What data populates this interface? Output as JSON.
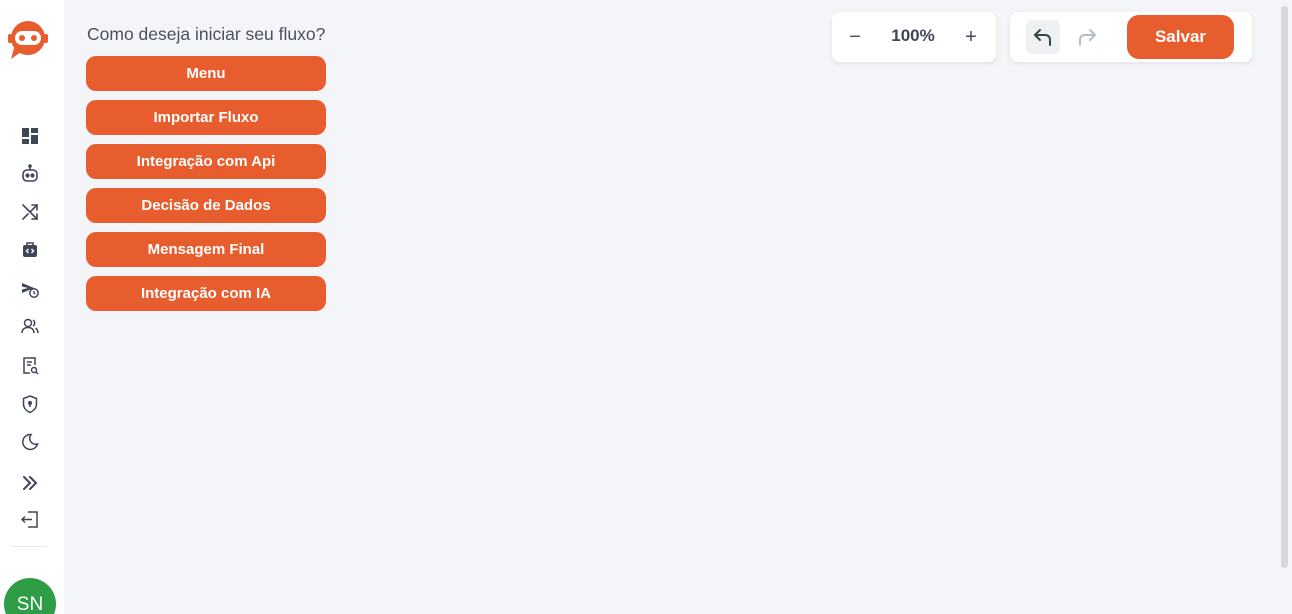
{
  "flow": {
    "prompt": "Como deseja iniciar seu fluxo?",
    "options": [
      "Menu",
      "Importar Fluxo",
      "Integração com Api",
      "Decisão de Dados",
      "Mensagem Final",
      "Integração com IA"
    ]
  },
  "toolbar": {
    "zoom_value": "100%",
    "zoom_out": "−",
    "zoom_in": "+",
    "save_label": "Salvar"
  },
  "user": {
    "initials": "SN"
  },
  "colors": {
    "accent": "#e85d2e",
    "avatar": "#2e9d45",
    "icon": "#3f4656",
    "background": "#f4f5f8"
  },
  "sidebar": {
    "icons": [
      "dashboard-icon",
      "robot-icon",
      "shuffle-icon",
      "code-bag-icon",
      "scheduled-send-icon",
      "contacts-icon",
      "report-search-icon",
      "shield-icon",
      "dark-mode-icon",
      "expand-sidebar-icon",
      "logout-icon"
    ]
  }
}
